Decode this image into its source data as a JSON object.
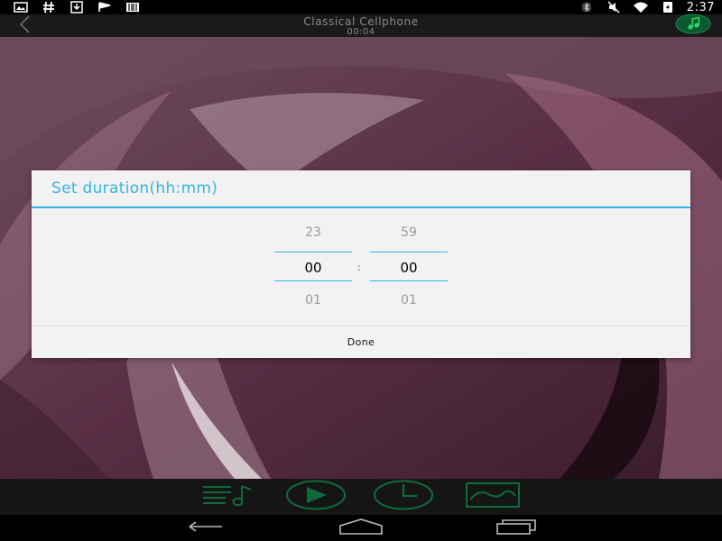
{
  "status_bar": {
    "time": "2:37",
    "left_icons": [
      "gallery-notification-icon",
      "hash-notification-icon",
      "download-notification-icon",
      "flag-notification-icon",
      "barcode-notification-icon"
    ],
    "right_icons": [
      "bluetooth-icon",
      "mute-icon",
      "wifi-icon",
      "battery-icon"
    ]
  },
  "action_bar": {
    "title": "Classical Cellphone",
    "subtitle": "00:04"
  },
  "dialog": {
    "title": "Set duration(hh:mm)",
    "hours": {
      "prev": "23",
      "current": "00",
      "next": "01"
    },
    "separator": ":",
    "minutes": {
      "prev": "59",
      "current": "00",
      "next": "01"
    },
    "done_label": "Done"
  },
  "player_bar": {
    "icons": [
      "playlist-icon",
      "play-icon",
      "timer-icon",
      "waveform-icon"
    ]
  },
  "colors": {
    "accent": "#33b5e5",
    "player_green": "#0f6b3c",
    "dialog_bg": "#f2f2f2"
  }
}
